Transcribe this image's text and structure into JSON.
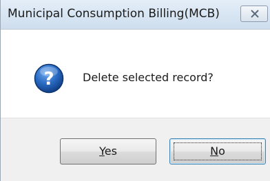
{
  "window": {
    "title": "Municipal Consumption Billing(MCB)"
  },
  "dialog": {
    "icon": "question-icon",
    "message": "Delete selected record?"
  },
  "buttons": {
    "yes": {
      "mnemonic": "Y",
      "rest": "es"
    },
    "no": {
      "mnemonic": "N",
      "rest": "o"
    }
  },
  "colors": {
    "icon_blue": "#1f5fb3",
    "focus_border": "#3c7fb1"
  }
}
